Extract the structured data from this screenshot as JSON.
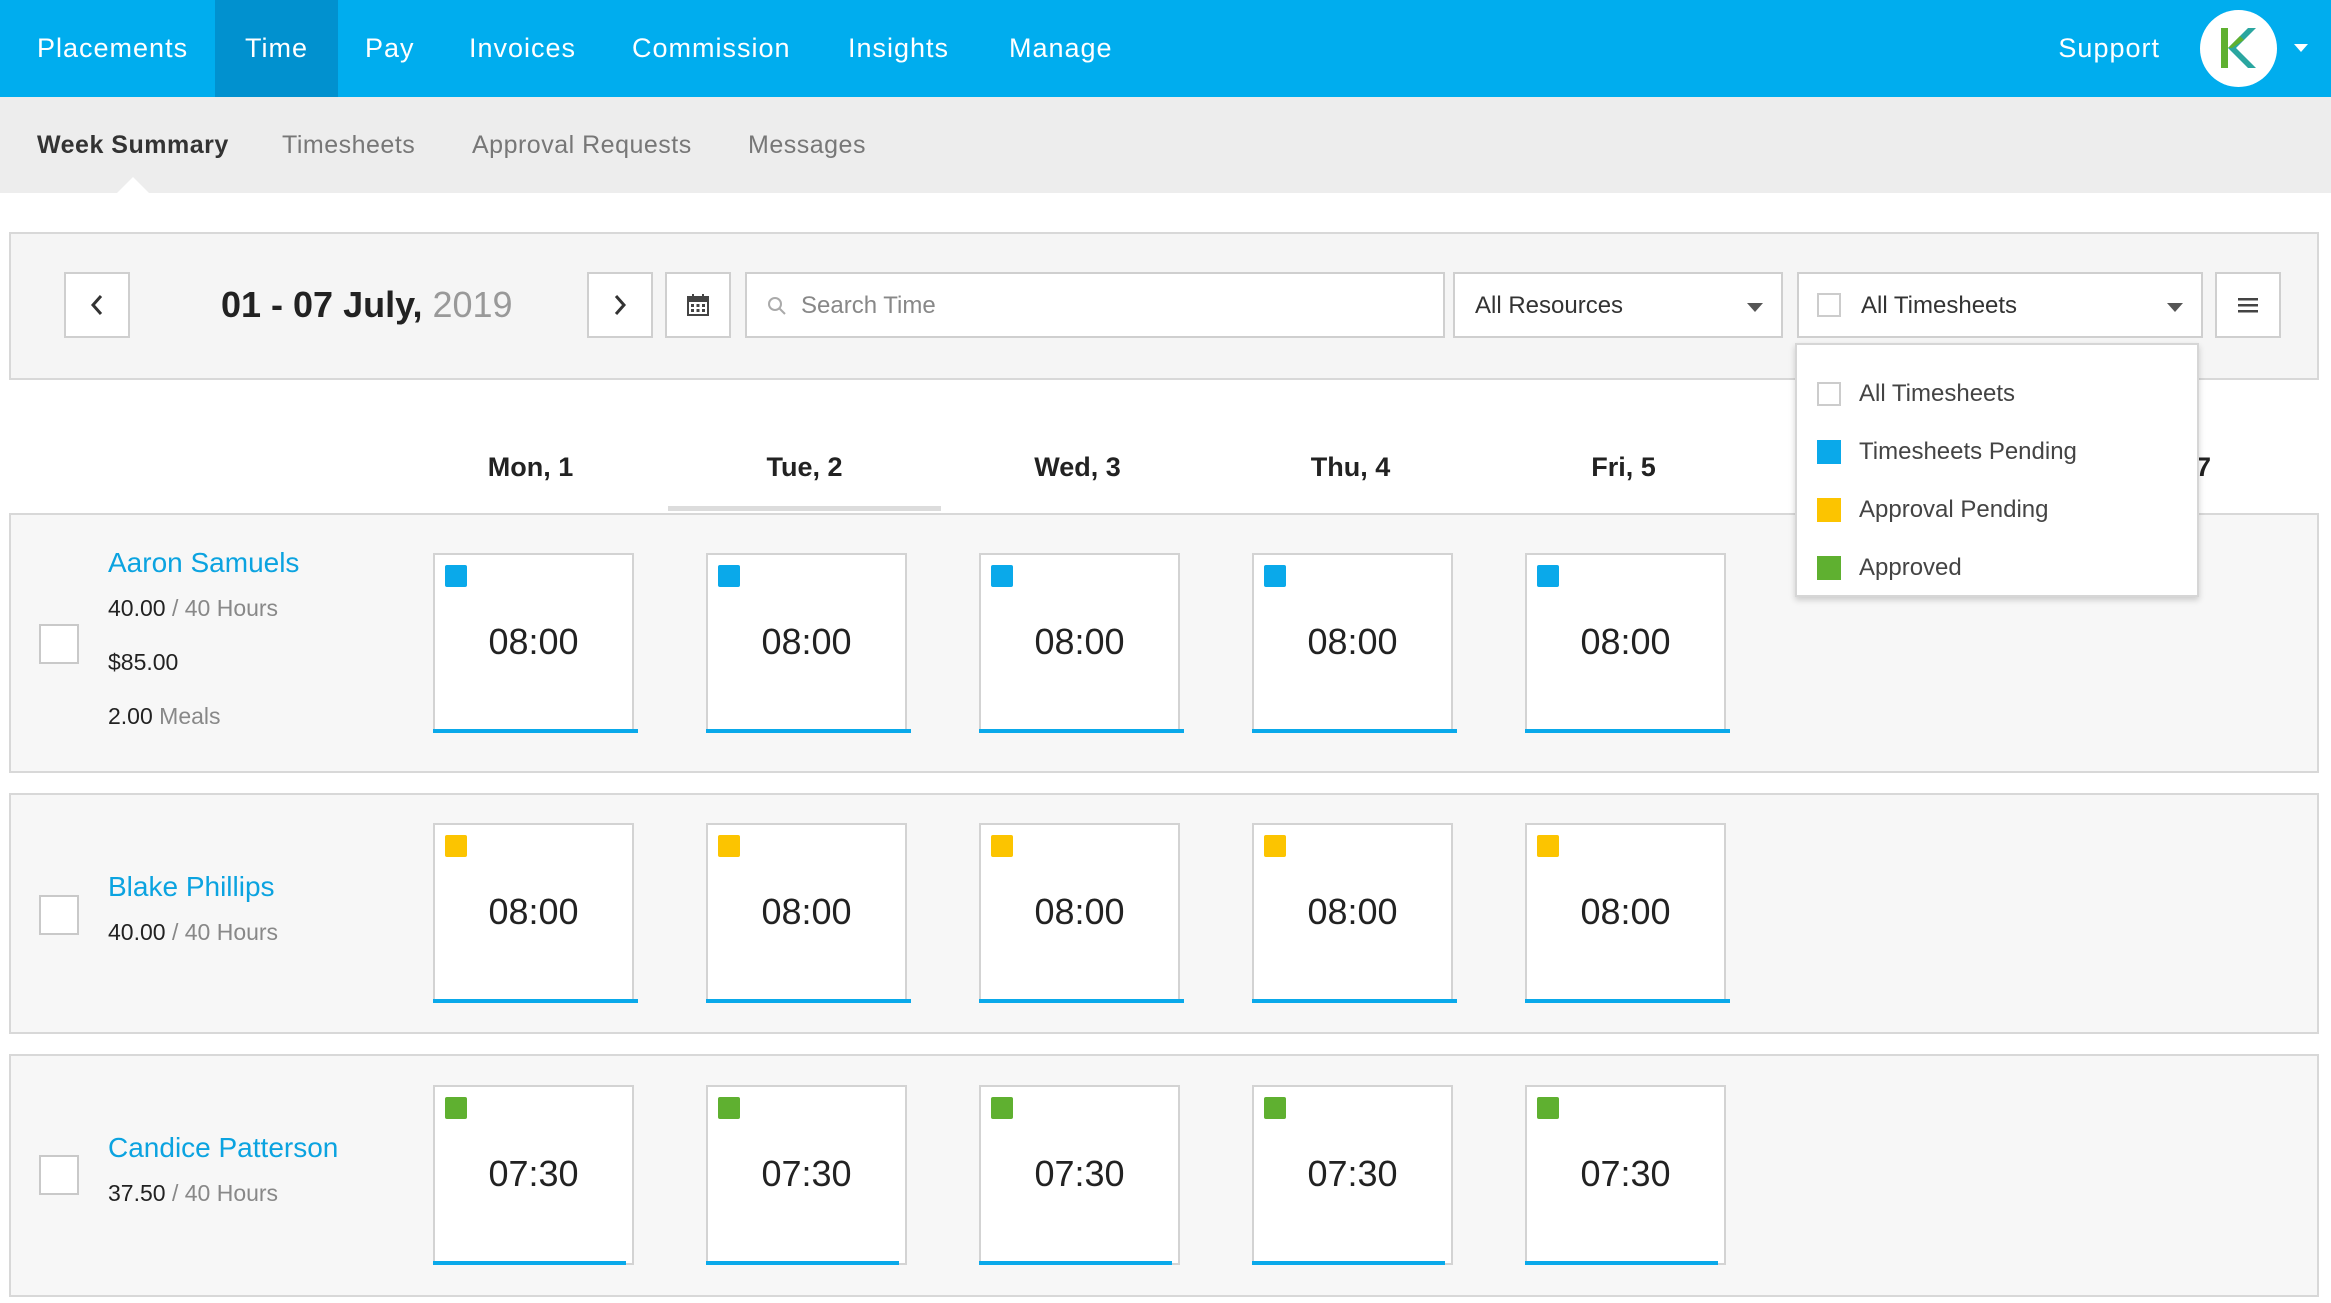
{
  "nav": {
    "items": [
      "Placements",
      "Time",
      "Pay",
      "Invoices",
      "Commission",
      "Insights",
      "Manage"
    ],
    "active": "Time",
    "support": "Support"
  },
  "subnav": {
    "items": [
      "Week Summary",
      "Timesheets",
      "Approval Requests",
      "Messages"
    ],
    "active": "Week Summary"
  },
  "toolbar": {
    "date_range": "01 - 07 July,",
    "year": "2019",
    "search_placeholder": "Search Time",
    "resources": "All Resources",
    "timesheets": "All Timesheets"
  },
  "dropdown": {
    "items": [
      {
        "label": "All Timesheets",
        "color": "#ffffff"
      },
      {
        "label": "Timesheets Pending",
        "color": "#0aa9ea"
      },
      {
        "label": "Approval Pending",
        "color": "#fcc400"
      },
      {
        "label": "Approved",
        "color": "#5fb030"
      }
    ]
  },
  "days": [
    "Mon, 1",
    "Tue, 2",
    "Wed, 3",
    "Thu, 4",
    "Fri, 5"
  ],
  "day_partial": "7",
  "colors": {
    "nav_bg": "#00adee",
    "nav_active": "#0191cf",
    "pending": "#0aa9ea",
    "approval_pending": "#fcc400",
    "approved": "#5fb030",
    "link": "#0ba3e0"
  },
  "rows": [
    {
      "name": "Aaron Samuels",
      "hours": "40.00",
      "of_hours": "/ 40 Hours",
      "money": "$85.00",
      "meals": "2.00",
      "meals_label": "Meals",
      "status_color": "#0aa9ea",
      "entries": [
        "08:00",
        "08:00",
        "08:00",
        "08:00",
        "08:00"
      ],
      "fill": [
        1,
        1,
        1,
        1,
        1
      ]
    },
    {
      "name": "Blake Phillips",
      "hours": "40.00",
      "of_hours": "/ 40 Hours",
      "status_color": "#fcc400",
      "entries": [
        "08:00",
        "08:00",
        "08:00",
        "08:00",
        "08:00"
      ],
      "fill": [
        1,
        1,
        1,
        1,
        1
      ]
    },
    {
      "name": "Candice Patterson",
      "hours": "37.50",
      "of_hours": "/ 40 Hours",
      "status_color": "#5fb030",
      "entries": [
        "07:30",
        "07:30",
        "07:30",
        "07:30",
        "07:30"
      ],
      "fill": [
        0.94,
        0.94,
        0.94,
        0.94,
        0.94
      ]
    }
  ]
}
